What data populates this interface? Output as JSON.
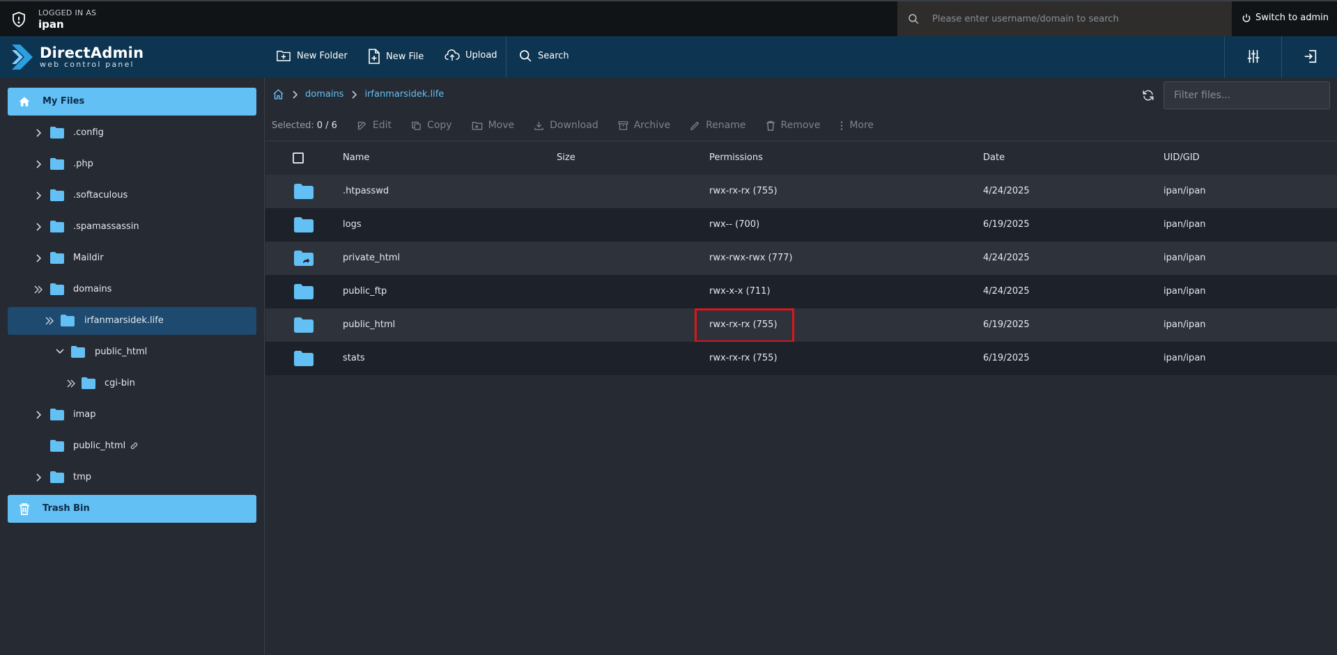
{
  "topbar": {
    "logged_in_label": "LOGGED IN AS",
    "username": "ipan",
    "search_placeholder": "Please enter username/domain to search",
    "switch_label": "Switch to admin"
  },
  "brand": {
    "title": "DirectAdmin",
    "subtitle": "web control panel"
  },
  "toolbar": {
    "new_folder": "New Folder",
    "new_file": "New File",
    "upload": "Upload",
    "search": "Search"
  },
  "sidebar": {
    "my_files": "My Files",
    "trash_bin": "Trash Bin",
    "items": [
      {
        "label": ".config"
      },
      {
        "label": ".php"
      },
      {
        "label": ".softaculous"
      },
      {
        "label": ".spamassassin"
      },
      {
        "label": "Maildir"
      },
      {
        "label": "domains"
      },
      {
        "label": "irfanmarsidek.life"
      },
      {
        "label": "public_html"
      },
      {
        "label": "cgi-bin"
      },
      {
        "label": "imap"
      },
      {
        "label": "public_html"
      },
      {
        "label": "tmp"
      }
    ]
  },
  "breadcrumb": {
    "items": [
      "domains",
      "irfanmarsidek.life"
    ]
  },
  "filter_placeholder": "Filter files...",
  "selection": {
    "label": "Selected:",
    "count": "0 / 6"
  },
  "actions": {
    "edit": "Edit",
    "copy": "Copy",
    "move": "Move",
    "download": "Download",
    "archive": "Archive",
    "rename": "Rename",
    "remove": "Remove",
    "more": "More"
  },
  "table": {
    "columns": {
      "name": "Name",
      "size": "Size",
      "permissions": "Permissions",
      "date": "Date",
      "uid": "UID/GID"
    },
    "rows": [
      {
        "name": ".htpasswd",
        "size": "",
        "permissions": "rwx-rx-rx (755)",
        "date": "4/24/2025",
        "uid": "ipan/ipan"
      },
      {
        "name": "logs",
        "size": "",
        "permissions": "rwx-- (700)",
        "date": "6/19/2025",
        "uid": "ipan/ipan"
      },
      {
        "name": "private_html",
        "size": "",
        "permissions": "rwx-rwx-rwx (777)",
        "date": "4/24/2025",
        "uid": "ipan/ipan"
      },
      {
        "name": "public_ftp",
        "size": "",
        "permissions": "rwx-x-x (711)",
        "date": "4/24/2025",
        "uid": "ipan/ipan"
      },
      {
        "name": "public_html",
        "size": "",
        "permissions": "rwx-rx-rx (755)",
        "date": "6/19/2025",
        "uid": "ipan/ipan"
      },
      {
        "name": "stats",
        "size": "",
        "permissions": "rwx-rx-rx (755)",
        "date": "6/19/2025",
        "uid": "ipan/ipan"
      }
    ]
  },
  "colors": {
    "accent": "#63c0f5",
    "header": "#0d3450",
    "topbar": "#111417",
    "highlight": "#e0141a"
  }
}
